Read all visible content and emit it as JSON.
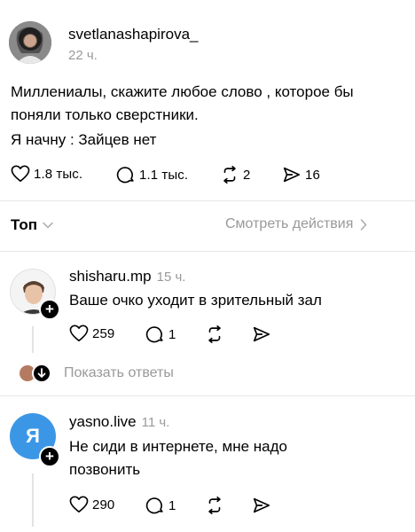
{
  "post": {
    "username": "svetlanashapirova_",
    "time": "22 ч.",
    "text_line1": "Миллениалы, скажите любое слово , которое бы",
    "text_line2": "поняли только сверстники.",
    "text_line3": "Я начну : Зайцев нет",
    "likes": "1.8 тыс.",
    "comments": "1.1 тыс.",
    "reposts": "2",
    "shares": "16"
  },
  "sort": {
    "label": "Топ",
    "view_activity": "Смотреть действия"
  },
  "replies": [
    {
      "username": "shisharu.mp",
      "time": "15 ч.",
      "text": "Ваше очко уходит в зрительный зал",
      "likes": "259",
      "comments": "1"
    },
    {
      "username": "yasno.live",
      "time": "11 ч.",
      "avatar_letter": "Я",
      "text_line1": "Не сиди в интернете, мне надо",
      "text_line2": "позвонить",
      "likes": "290",
      "comments": "1"
    }
  ],
  "show_replies": "Показать ответы",
  "colors": {
    "accent_blue": "#3b97e5",
    "muted": "#999999",
    "divider": "#e6e6e6"
  }
}
